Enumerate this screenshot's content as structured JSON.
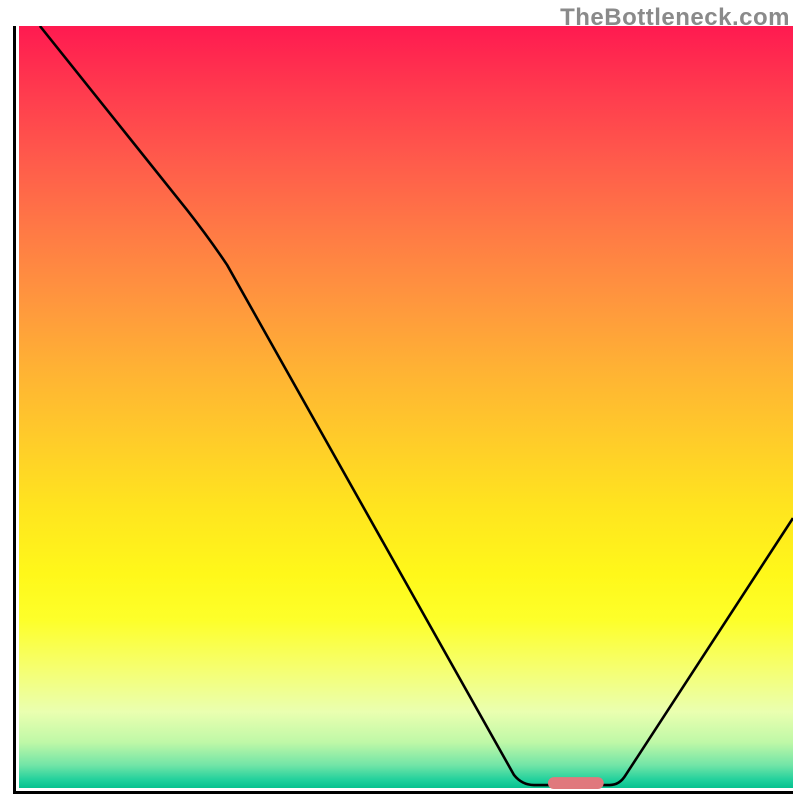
{
  "watermark": "TheBottleneck.com",
  "chart_data": {
    "type": "line",
    "title": "",
    "xlabel": "",
    "ylabel": "",
    "x": [
      0.03,
      0.22,
      0.64,
      0.68,
      0.77,
      1.0
    ],
    "values": [
      1.0,
      0.76,
      0.02,
      0.02,
      0.02,
      0.36
    ],
    "xlim": [
      0,
      1
    ],
    "ylim": [
      0,
      1
    ],
    "optimum_range_x": [
      0.685,
      0.755
    ],
    "gradient_stops": [
      {
        "pos": 0.0,
        "color": "#ff1a50"
      },
      {
        "pos": 0.5,
        "color": "#ffbe2e"
      },
      {
        "pos": 0.78,
        "color": "#fdff2a"
      },
      {
        "pos": 1.0,
        "color": "#06c28f"
      }
    ]
  }
}
